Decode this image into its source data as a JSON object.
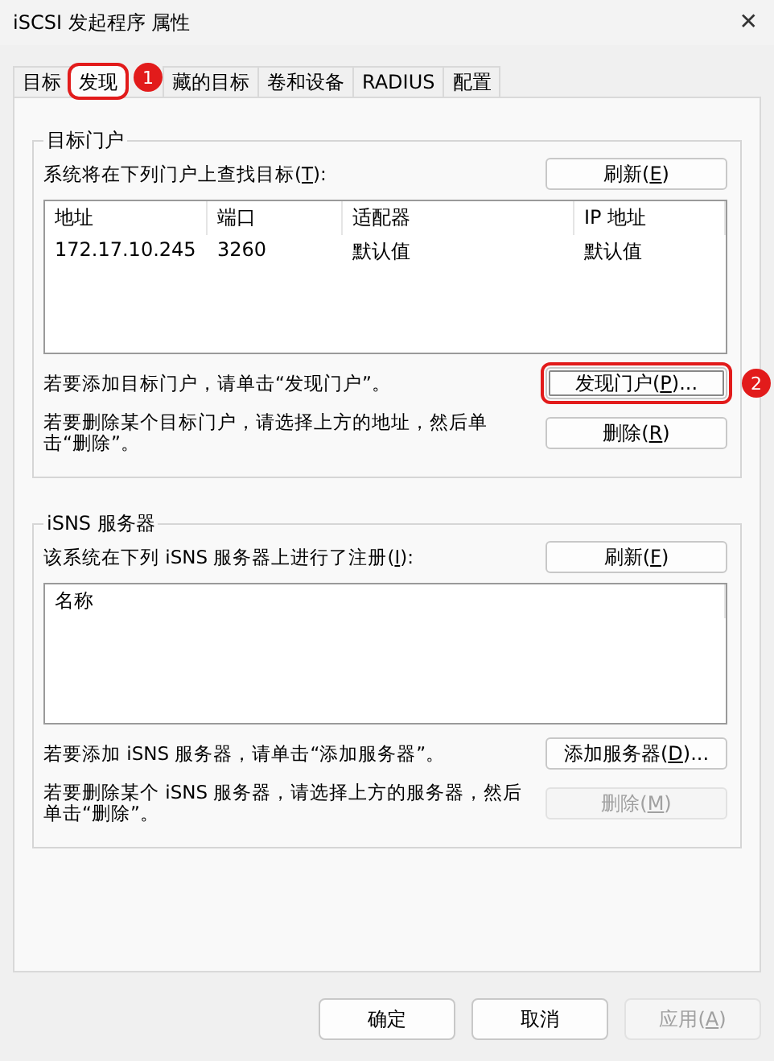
{
  "window": {
    "title": "iSCSI 发起程序 属性",
    "close": "✕"
  },
  "tabs": [
    {
      "label": "目标",
      "selected": false
    },
    {
      "label": "发现",
      "selected": true,
      "annotation": "1"
    },
    {
      "label": "藏的目标",
      "selected": false
    },
    {
      "label": "卷和设备",
      "selected": false
    },
    {
      "label": "RADIUS",
      "selected": false
    },
    {
      "label": "配置",
      "selected": false
    }
  ],
  "portal_group": {
    "title": "目标门户",
    "list_label": {
      "before": "系统将在下列门户上查找目标(",
      "key": "T",
      "after": "):"
    },
    "refresh": {
      "before": "刷新(",
      "key": "E",
      "after": ")",
      "disabled": false,
      "focused": false
    },
    "columns": [
      "地址",
      "端口",
      "适配器",
      "IP 地址"
    ],
    "rows": [
      [
        "172.17.10.245",
        "3260",
        "默认值",
        "默认值"
      ]
    ],
    "actions": [
      {
        "text": "若要添加目标门户，请单击“发现门户”。",
        "button": {
          "before": "发现门户(",
          "key": "P",
          "after": ")...",
          "disabled": false,
          "focused": true,
          "annotation": "2"
        }
      },
      {
        "text": "若要删除某个目标门户，请选择上方的地址，然后单击“删除”。",
        "button": {
          "before": "删除(",
          "key": "R",
          "after": ")",
          "disabled": false,
          "focused": false
        }
      }
    ]
  },
  "isns_group": {
    "title": "iSNS 服务器",
    "list_label": {
      "before": "该系统在下列 iSNS 服务器上进行了注册(",
      "key": "I",
      "after": "):"
    },
    "refresh": {
      "before": "刷新(",
      "key": "F",
      "after": ")",
      "disabled": false,
      "focused": false
    },
    "columns": [
      "名称"
    ],
    "actions": [
      {
        "text": "若要添加 iSNS 服务器，请单击“添加服务器”。",
        "button": {
          "before": "添加服务器(",
          "key": "D",
          "after": ")...",
          "disabled": false,
          "focused": false
        }
      },
      {
        "text": "若要删除某个 iSNS 服务器，请选择上方的服务器，然后单击“删除”。",
        "button": {
          "before": "删除(",
          "key": "M",
          "after": ")",
          "disabled": true,
          "focused": false
        }
      }
    ]
  },
  "footer": [
    {
      "before": "确定",
      "disabled": false
    },
    {
      "before": "取消",
      "disabled": false
    },
    {
      "before": "应用(",
      "key": "A",
      "after": ")",
      "disabled": true
    }
  ]
}
